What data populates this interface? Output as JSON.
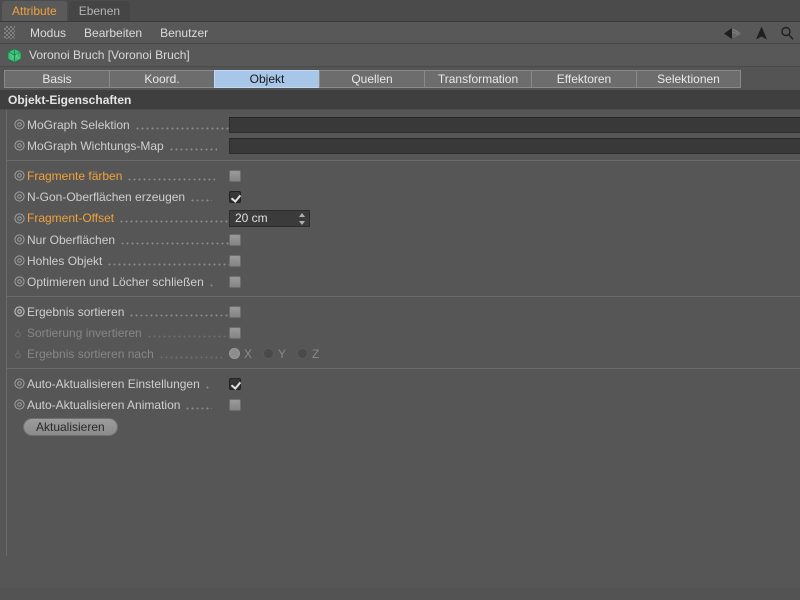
{
  "window_tabs": [
    {
      "label": "Attribute",
      "active": true
    },
    {
      "label": "Ebenen",
      "active": false
    }
  ],
  "menubar": {
    "grip_icon": "grip-dots-icon",
    "items": [
      "Modus",
      "Bearbeiten",
      "Benutzer"
    ],
    "icons": [
      "back-arrow-icon",
      "up-arrow-icon",
      "search-icon"
    ]
  },
  "object_header": {
    "icon": "voronoi-fracture-object-icon",
    "title": "Voronoi Bruch [Voronoi Bruch]"
  },
  "property_tabs": [
    {
      "label": "Basis",
      "active": false
    },
    {
      "label": "Koord.",
      "active": false
    },
    {
      "label": "Objekt",
      "active": true
    },
    {
      "label": "Quellen",
      "active": false
    },
    {
      "label": "Transformation",
      "active": false
    },
    {
      "label": "Effektoren",
      "active": false
    },
    {
      "label": "Selektionen",
      "active": false
    }
  ],
  "section": {
    "title": "Objekt-Eigenschaften"
  },
  "properties": {
    "group1": [
      {
        "label": "MoGraph Selektion",
        "type": "textfield",
        "value": "",
        "animated": false,
        "disabled": false
      },
      {
        "label": "MoGraph Wichtungs-Map",
        "type": "textfield",
        "value": "",
        "animated": false,
        "disabled": false
      }
    ],
    "group2": [
      {
        "label": "Fragmente färben",
        "type": "checkbox",
        "checked": false,
        "animated": true,
        "disabled": false
      },
      {
        "label": "N-Gon-Oberflächen erzeugen",
        "type": "checkbox",
        "checked": true,
        "animated": false,
        "disabled": false
      },
      {
        "label": "Fragment-Offset",
        "type": "number",
        "value": "20 cm",
        "animated": true,
        "disabled": false
      },
      {
        "label": "Nur Oberflächen",
        "type": "checkbox",
        "checked": false,
        "animated": false,
        "disabled": false
      },
      {
        "label": "Hohles Objekt",
        "type": "checkbox",
        "checked": false,
        "animated": false,
        "disabled": false
      },
      {
        "label": "Optimieren und Löcher schließen",
        "type": "checkbox",
        "checked": false,
        "animated": false,
        "disabled": false
      }
    ],
    "group3": [
      {
        "label": "Ergebnis sortieren",
        "type": "checkbox",
        "checked": false,
        "animated": false,
        "disabled": false
      },
      {
        "label": "Sortierung invertieren",
        "type": "checkbox",
        "checked": false,
        "animated": false,
        "disabled": true
      },
      {
        "label": "Ergebnis sortieren nach",
        "type": "radio",
        "options": [
          "X",
          "Y",
          "Z"
        ],
        "selected": "X",
        "animated": false,
        "disabled": true
      }
    ],
    "group4": [
      {
        "label": "Auto-Aktualisieren Einstellungen",
        "type": "checkbox",
        "checked": true,
        "animated": false,
        "disabled": false
      },
      {
        "label": "Auto-Aktualisieren Animation",
        "type": "checkbox",
        "checked": false,
        "animated": false,
        "disabled": false
      }
    ],
    "update_button": {
      "label": "Aktualisieren"
    }
  },
  "colors": {
    "accent_orange": "#f0a23c",
    "active_tab_blue": "#a7c6e8",
    "panel_bg": "#565656",
    "object_icon_green": "#3fbf77"
  }
}
